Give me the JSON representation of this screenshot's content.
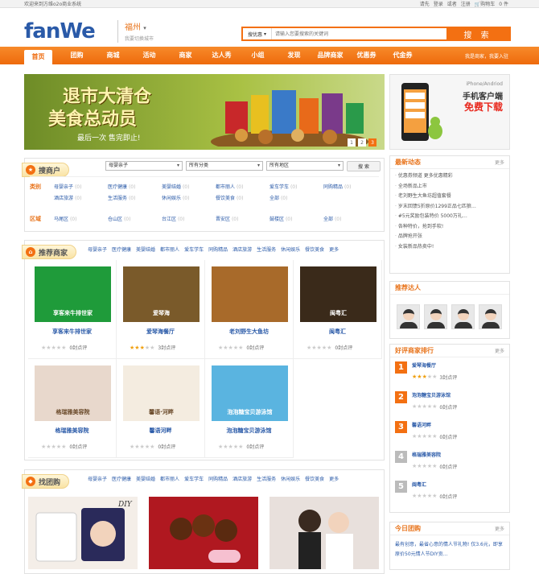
{
  "topbar": {
    "left": "欢迎来到方维o2o商业系统",
    "links": [
      "请先",
      "登录",
      "或者",
      "注册",
      "购物车",
      "0 件"
    ]
  },
  "logo": {
    "text1": "fan",
    "text2": "We"
  },
  "city": {
    "name": "福州",
    "switch": "我要切换城市"
  },
  "search": {
    "scope": "搜优惠",
    "placeholder": "请输入您要搜索的关键词",
    "button": "搜 索"
  },
  "nav": {
    "items": [
      "首页",
      "团购",
      "商城",
      "活动",
      "商家",
      "达人秀",
      "小组",
      "发现",
      "品牌商家",
      "优惠券",
      "代金券"
    ],
    "right": "我是商家，我要入驻"
  },
  "banner": {
    "line1": "退市大清仓",
    "line2": "美食总动员",
    "line3": "最后一次 售完即止!",
    "pages": [
      "1",
      "2",
      "3"
    ]
  },
  "app_ad": {
    "line1": "iPhone/Andriod",
    "line2": "手机客户端",
    "line3": "免费下载"
  },
  "news": {
    "title": "最新动态",
    "more": "更多",
    "items": [
      "优惠券频道 更多优惠精彩",
      "全场新品上市",
      "老刘野生大鱼坊超值套餐",
      "岁末回馈5折原价1299正品七匹狼…",
      "#5元奖励包装特价 5000万礼…",
      "各种特价，抢到手软!",
      "品牌抢开张",
      "女装新品热卖中!"
    ]
  },
  "talent": {
    "title": "推荐达人"
  },
  "rank": {
    "title": "好评商家排行",
    "more": "更多",
    "items": [
      {
        "n": "1",
        "name": "爱琴海餐厅",
        "reviews": "3封点评",
        "stars": 3
      },
      {
        "n": "2",
        "name": "泡泡糖宝贝游泳馆",
        "reviews": "0封点评",
        "stars": 0
      },
      {
        "n": "3",
        "name": "馨语河畔",
        "reviews": "0封点评",
        "stars": 0
      },
      {
        "n": "4",
        "name": "格瑞雅美容院",
        "reviews": "0封点评",
        "stars": 0
      },
      {
        "n": "5",
        "name": "闽粤汇",
        "reviews": "0封点评",
        "stars": 0
      }
    ]
  },
  "today": {
    "title": "今日团购",
    "more": "更多",
    "text": "最有创意，最省心意的情人节礼物! 仅3.6元，即享原价50元情人节DIY贡…"
  },
  "shop_search": {
    "tag": "搜商户",
    "filters": [
      "母婴亲子",
      "所有分类",
      "所有地区"
    ],
    "button": "搜 索",
    "cat_label": "类别",
    "area_label": "区域",
    "categories": [
      {
        "n": "母婴亲子",
        "c": "(0)"
      },
      {
        "n": "医疗健康",
        "c": "(0)"
      },
      {
        "n": "美婴结婚",
        "c": "(0)"
      },
      {
        "n": "都市丽人",
        "c": "(0)"
      },
      {
        "n": "爱车学车",
        "c": "(0)"
      },
      {
        "n": "同购精品",
        "c": "(0)"
      },
      {
        "n": "酒店旅游",
        "c": "(0)"
      },
      {
        "n": "生活服务",
        "c": "(0)"
      },
      {
        "n": "休闲娱乐",
        "c": "(0)"
      },
      {
        "n": "餐饮美食",
        "c": "(0)"
      },
      {
        "n": "全部",
        "c": "(0)"
      }
    ],
    "areas": [
      {
        "n": "马尾区",
        "c": "(0)"
      },
      {
        "n": "仓山区",
        "c": "(0)"
      },
      {
        "n": "台江区",
        "c": "(0)"
      },
      {
        "n": "晋安区",
        "c": "(0)"
      },
      {
        "n": "鼓楼区",
        "c": "(0)"
      },
      {
        "n": "全部",
        "c": "(0)"
      }
    ]
  },
  "shops": {
    "tag": "推荐商家",
    "more": "更多",
    "subnav": [
      "母婴亲子",
      "医疗健康",
      "美婴结婚",
      "都市丽人",
      "爱车学车",
      "同购精品",
      "酒店旅游",
      "生活服务",
      "休闲娱乐",
      "餐饮美食",
      "更多"
    ],
    "items": [
      {
        "name": "享客来牛排世家",
        "reviews": "0封点评",
        "stars": 0,
        "img_text": "享客来牛排世家",
        "color": "#1f9b3a"
      },
      {
        "name": "爱琴海餐厅",
        "reviews": "3封点评",
        "stars": 3,
        "img_text": "爱琴海",
        "color": "#7a5a2a"
      },
      {
        "name": "老刘野生大鱼坊",
        "reviews": "0封点评",
        "stars": 0,
        "img_text": "",
        "color": "#a86a2a"
      },
      {
        "name": "闽粤汇",
        "reviews": "0封点评",
        "stars": 0,
        "img_text": "闽粤汇",
        "color": "#3a2a1a"
      },
      {
        "name": "格瑞雅美容院",
        "reviews": "0封点评",
        "stars": 0,
        "img_text": "格瑞雅美容院",
        "color": "#e8d8cc"
      },
      {
        "name": "馨语河畔",
        "reviews": "0封点评",
        "stars": 0,
        "img_text": "馨语·河畔",
        "color": "#f4ece0"
      },
      {
        "name": "泡泡糖宝贝游泳馆",
        "reviews": "0封点评",
        "stars": 0,
        "img_text": "泡泡糖宝贝游泳馆",
        "color": "#5ab4e0"
      }
    ]
  },
  "group": {
    "tag": "找团购",
    "subnav": [
      "母婴亲子",
      "医疗健康",
      "美婴结婚",
      "都市丽人",
      "爱车学车",
      "同购精品",
      "酒店旅游",
      "生活服务",
      "休闲娱乐",
      "餐饮美食",
      "更多"
    ],
    "img1_text": "DIY"
  }
}
